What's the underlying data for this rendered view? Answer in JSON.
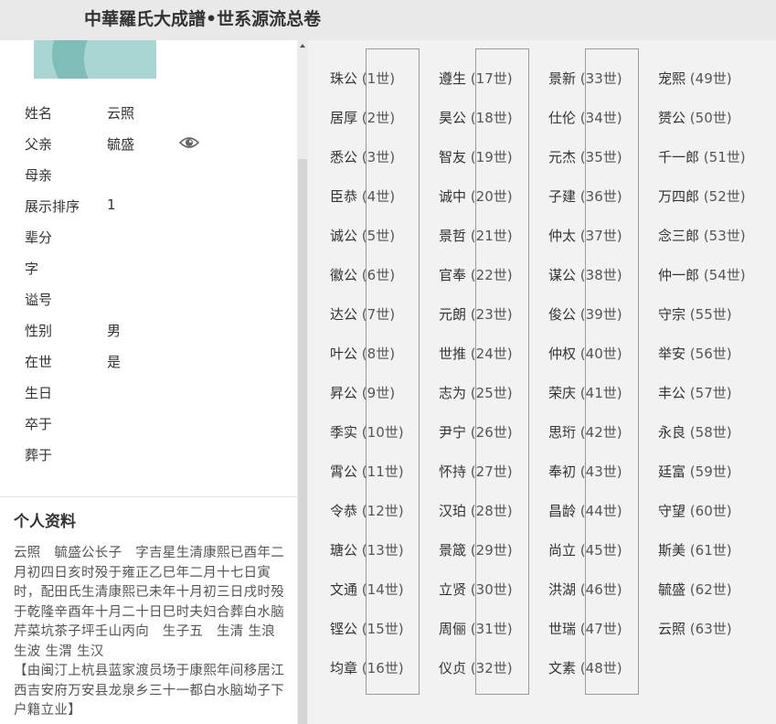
{
  "header": {
    "title": "中華羅氏大成譜•世系源流总卷"
  },
  "profile": {
    "fields": [
      {
        "label": "姓名",
        "value": "云照"
      },
      {
        "label": "父亲",
        "value": "毓盛"
      },
      {
        "label": "母亲",
        "value": ""
      },
      {
        "label": "展示排序",
        "value": "1"
      },
      {
        "label": "辈分",
        "value": ""
      },
      {
        "label": "字",
        "value": ""
      },
      {
        "label": "谥号",
        "value": ""
      },
      {
        "label": "性别",
        "value": "男"
      },
      {
        "label": "在世",
        "value": "是"
      },
      {
        "label": "生日",
        "value": ""
      },
      {
        "label": "卒于",
        "value": ""
      },
      {
        "label": "葬于",
        "value": ""
      }
    ],
    "icons": {
      "view": "eye-icon"
    }
  },
  "personal": {
    "title": "个人资料",
    "bio": "云照　毓盛公长子　字吉星生清康熙已酉年二月初四日亥时殁于雍正乙巳年二月十七日寅时，配田氏生清康熙已未年十月初三日戌时殁于乾隆辛酉年十月二十日巳时夫妇合葬白水脑芹菜坑茶子坪壬山丙向　生子五　生清 生浪 生波 生渭 生汉\n【由闽汀上杭县蓝家渡员场于康熙年间移居江西吉安府万安县龙泉乡三十一都白水脑坳子下户籍立业】"
  },
  "generations": [
    {
      "name": "珠公",
      "gen": "(1世)"
    },
    {
      "name": "居厚",
      "gen": "(2世)"
    },
    {
      "name": "悉公",
      "gen": "(3世)"
    },
    {
      "name": "臣恭",
      "gen": "(4世)"
    },
    {
      "name": "诚公",
      "gen": "(5世)"
    },
    {
      "name": "徽公",
      "gen": "(6世)"
    },
    {
      "name": "达公",
      "gen": "(7世)"
    },
    {
      "name": "叶公",
      "gen": "(8世)"
    },
    {
      "name": "昇公",
      "gen": "(9世)"
    },
    {
      "name": "季实",
      "gen": "(10世)"
    },
    {
      "name": "霄公",
      "gen": "(11世)"
    },
    {
      "name": "令恭",
      "gen": "(12世)"
    },
    {
      "name": "瑭公",
      "gen": "(13世)"
    },
    {
      "name": "文通",
      "gen": "(14世)"
    },
    {
      "name": "铿公",
      "gen": "(15世)"
    },
    {
      "name": "均章",
      "gen": "(16世)"
    },
    {
      "name": "遵生",
      "gen": "(17世)"
    },
    {
      "name": "昊公",
      "gen": "(18世)"
    },
    {
      "name": "智友",
      "gen": "(19世)"
    },
    {
      "name": "诚中",
      "gen": "(20世)"
    },
    {
      "name": "景哲",
      "gen": "(21世)"
    },
    {
      "name": "官奉",
      "gen": "(22世)"
    },
    {
      "name": "元朗",
      "gen": "(23世)"
    },
    {
      "name": "世推",
      "gen": "(24世)"
    },
    {
      "name": "志为",
      "gen": "(25世)"
    },
    {
      "name": "尹宁",
      "gen": "(26世)"
    },
    {
      "name": "怀持",
      "gen": "(27世)"
    },
    {
      "name": "汉珀",
      "gen": "(28世)"
    },
    {
      "name": "景箴",
      "gen": "(29世)"
    },
    {
      "name": "立贤",
      "gen": "(30世)"
    },
    {
      "name": "周俪",
      "gen": "(31世)"
    },
    {
      "name": "仪贞",
      "gen": "(32世)"
    },
    {
      "name": "景新",
      "gen": "(33世)"
    },
    {
      "name": "仕伦",
      "gen": "(34世)"
    },
    {
      "name": "元杰",
      "gen": "(35世)"
    },
    {
      "name": "子建",
      "gen": "(36世)"
    },
    {
      "name": "仲太",
      "gen": "(37世)"
    },
    {
      "name": "谋公",
      "gen": "(38世)"
    },
    {
      "name": "俊公",
      "gen": "(39世)"
    },
    {
      "name": "仲权",
      "gen": "(40世)"
    },
    {
      "name": "荣庆",
      "gen": "(41世)"
    },
    {
      "name": "思珩",
      "gen": "(42世)"
    },
    {
      "name": "奉初",
      "gen": "(43世)"
    },
    {
      "name": "昌龄",
      "gen": "(44世)"
    },
    {
      "name": "尚立",
      "gen": "(45世)"
    },
    {
      "name": "洪湖",
      "gen": "(46世)"
    },
    {
      "name": "世瑞",
      "gen": "(47世)"
    },
    {
      "name": "文素",
      "gen": "(48世)"
    },
    {
      "name": "宠熙",
      "gen": "(49世)"
    },
    {
      "name": "赟公",
      "gen": "(50世)"
    },
    {
      "name": "千一郎",
      "gen": "(51世)"
    },
    {
      "name": "万四郎",
      "gen": "(52世)"
    },
    {
      "name": "念三郎",
      "gen": "(53世)"
    },
    {
      "name": "仲一郎",
      "gen": "(54世)"
    },
    {
      "name": "守宗",
      "gen": "(55世)"
    },
    {
      "name": "举安",
      "gen": "(56世)"
    },
    {
      "name": "丰公",
      "gen": "(57世)"
    },
    {
      "name": "永良",
      "gen": "(58世)"
    },
    {
      "name": "廷富",
      "gen": "(59世)"
    },
    {
      "name": "守望",
      "gen": "(60世)"
    },
    {
      "name": "斯美",
      "gen": "(61世)"
    },
    {
      "name": "毓盛",
      "gen": "(62世)"
    },
    {
      "name": "云照",
      "gen": "(63世)"
    }
  ]
}
